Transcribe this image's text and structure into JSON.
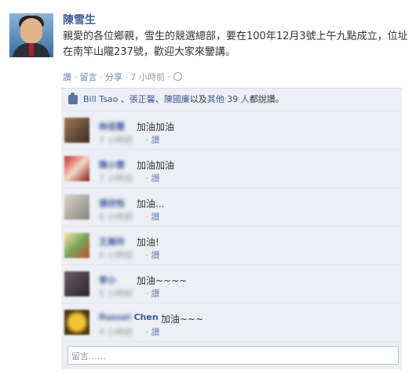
{
  "post": {
    "author": "陳雪生",
    "message": "親愛的各位鄉親，雪生的競選總部，要在100年12月3號上午九點成立，位址在南竿山隴237號，歡迎大家來鑒講。",
    "actions": {
      "like": "讚",
      "comment": "留言",
      "share": "分享",
      "time": "7 小時前",
      "globe_icon": "globe-icon"
    }
  },
  "likes": {
    "text_pre": "Bill Tsao",
    "sep1": "、",
    "name2": "張正馨",
    "sep2": "、",
    "name3": "陳國廉",
    "mid": "以及",
    "others": "其他 39 人",
    "suffix": "都說讚。"
  },
  "comments": [
    {
      "name": "林佳慧",
      "text": "加油加油",
      "time": "7 小時前",
      "like": "讚"
    },
    {
      "name": "陳小雯",
      "text": "加油加油",
      "time": "7 小時前",
      "like": "讚"
    },
    {
      "name": "張欣怡",
      "text": "加油...",
      "time": "6 小時前",
      "like": "讚"
    },
    {
      "name": "王美玲",
      "text": "加油!",
      "time": "6 小時前",
      "like": "讚"
    },
    {
      "name": "李小",
      "text": "加油~~~~",
      "time": "5 小時前",
      "like": "讚"
    },
    {
      "name_blur": "Russel",
      "name_clear": "Chen",
      "text": "加油~~~",
      "time": "4 小時前",
      "like": "讚"
    }
  ],
  "comment_input": {
    "placeholder": "留言……"
  }
}
